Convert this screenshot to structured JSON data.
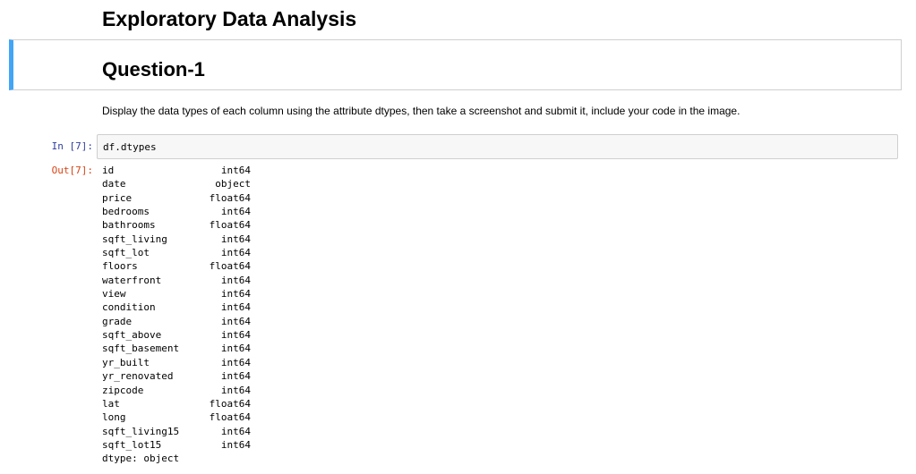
{
  "notebook": {
    "title": "Exploratory Data Analysis",
    "section_heading": "Question-1",
    "instruction": "Display the data types of each column using the attribute dtypes, then take a screenshot and submit it, include your code in the image.",
    "cell": {
      "in_prompt": "In [7]:",
      "out_prompt": "Out[7]:",
      "code": "df.dtypes",
      "output_rows": [
        {
          "name": "id",
          "type": "int64"
        },
        {
          "name": "date",
          "type": "object"
        },
        {
          "name": "price",
          "type": "float64"
        },
        {
          "name": "bedrooms",
          "type": "int64"
        },
        {
          "name": "bathrooms",
          "type": "float64"
        },
        {
          "name": "sqft_living",
          "type": "int64"
        },
        {
          "name": "sqft_lot",
          "type": "int64"
        },
        {
          "name": "floors",
          "type": "float64"
        },
        {
          "name": "waterfront",
          "type": "int64"
        },
        {
          "name": "view",
          "type": "int64"
        },
        {
          "name": "condition",
          "type": "int64"
        },
        {
          "name": "grade",
          "type": "int64"
        },
        {
          "name": "sqft_above",
          "type": "int64"
        },
        {
          "name": "sqft_basement",
          "type": "int64"
        },
        {
          "name": "yr_built",
          "type": "int64"
        },
        {
          "name": "yr_renovated",
          "type": "int64"
        },
        {
          "name": "zipcode",
          "type": "int64"
        },
        {
          "name": "lat",
          "type": "float64"
        },
        {
          "name": "long",
          "type": "float64"
        },
        {
          "name": "sqft_living15",
          "type": "int64"
        },
        {
          "name": "sqft_lot15",
          "type": "int64"
        }
      ],
      "dtype_footer": "dtype: object"
    }
  },
  "colors": {
    "markdown_selected_bar": "#42a5f5",
    "in_prompt": "#303f9f",
    "out_prompt": "#d84315",
    "input_background": "#f7f7f7",
    "cell_border": "#cfcfcf"
  }
}
